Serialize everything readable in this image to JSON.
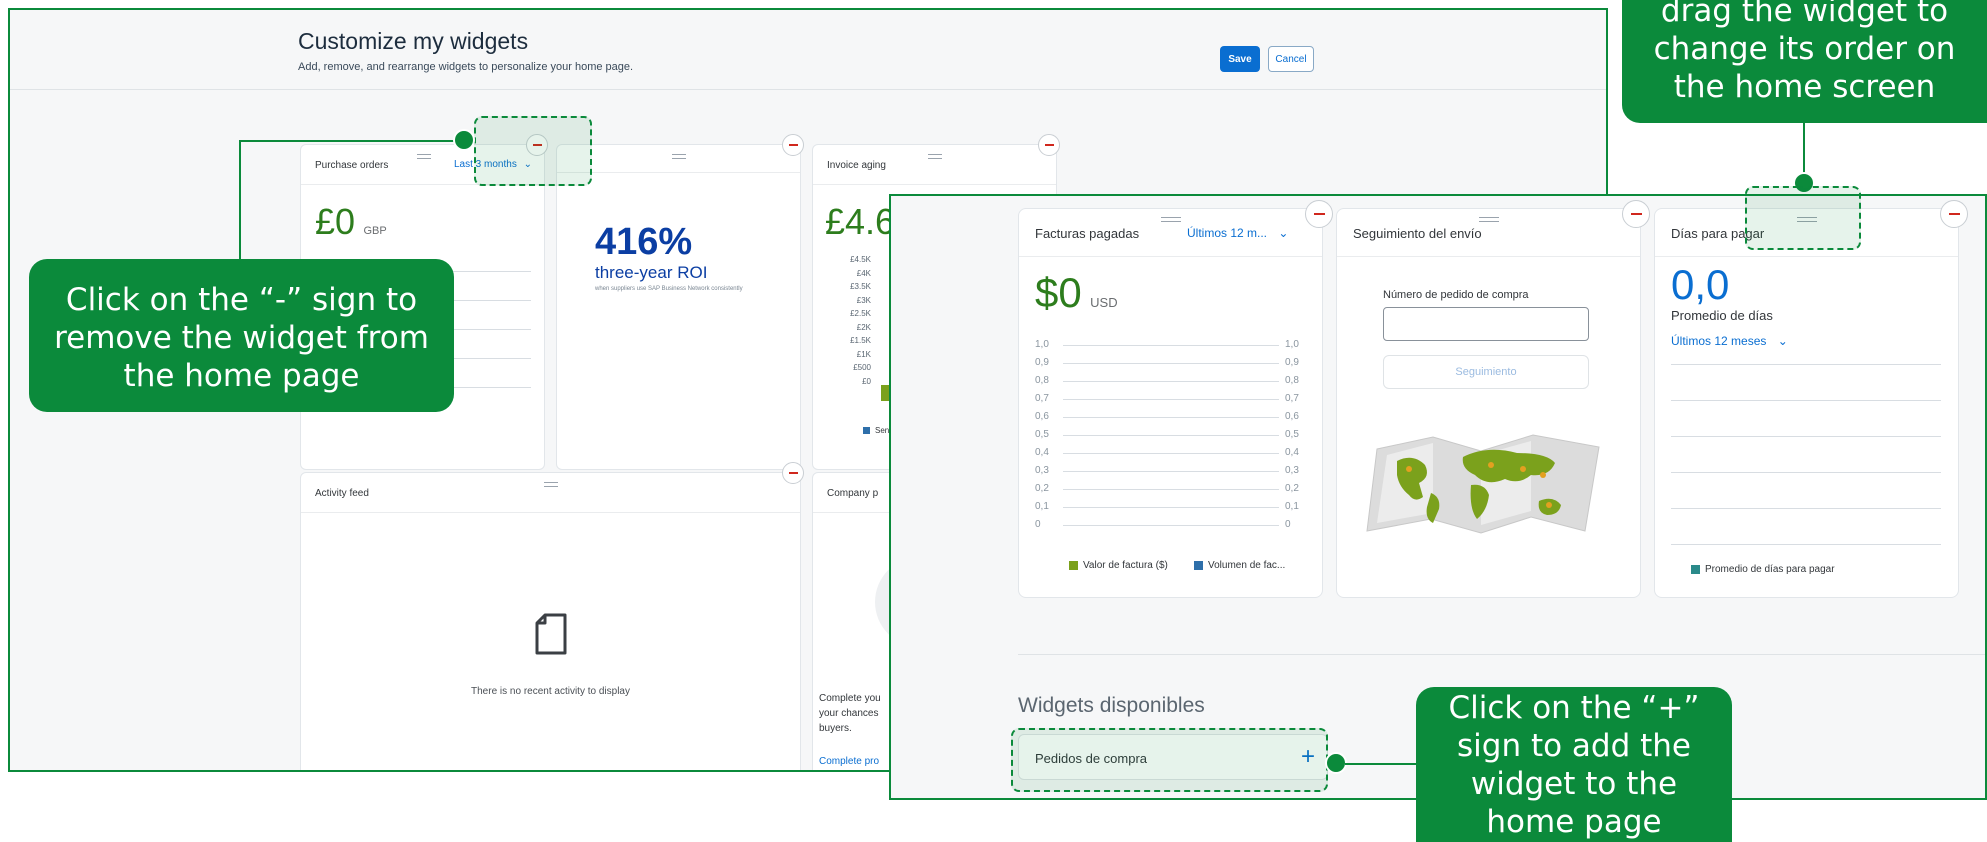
{
  "screen1": {
    "title": "Customize my widgets",
    "subtitle": "Add, remove, and rearrange widgets to personalize your home page.",
    "save_label": "Save",
    "cancel_label": "Cancel",
    "purchase_orders": {
      "title": "Purchase orders",
      "filter": "Last 3 months",
      "amount": "£0",
      "currency": "GBP"
    },
    "roi": {
      "value": "416%",
      "label": "three-year ROI",
      "note": "when suppliers use SAP Business Network consistently"
    },
    "invoice_aging": {
      "title": "Invoice aging",
      "amount": "£4.6",
      "y_ticks": [
        "£4.5K",
        "£4K",
        "£3.5K",
        "£3K",
        "£2.5K",
        "£2K",
        "£1.5K",
        "£1K",
        "£500",
        "£0"
      ],
      "legend": "Sen"
    },
    "activity_feed": {
      "title": "Activity feed",
      "empty_text": "There is no recent activity to display"
    },
    "company_profile": {
      "title": "Company p",
      "text": "Complete you your chances buyers.",
      "link": "Complete pro"
    }
  },
  "screen2": {
    "facturas": {
      "title": "Facturas pagadas",
      "filter": "Últimos 12 m...",
      "amount": "$0",
      "currency": "USD",
      "y_ticks": [
        "1,0",
        "0,9",
        "0,8",
        "0,7",
        "0,6",
        "0,5",
        "0,4",
        "0,3",
        "0,2",
        "0,1",
        "0"
      ],
      "legend_1": "Valor de factura ($)",
      "legend_2": "Volumen de fac...",
      "legend_1_color": "#7ba11c",
      "legend_2_color": "#2e6faa"
    },
    "seguimiento": {
      "title": "Seguimiento del envío",
      "field_label": "Número de pedido de compra",
      "field_value": "",
      "button": "Seguimiento"
    },
    "dias": {
      "title": "Días para pagar",
      "value": "0,0",
      "label": "Promedio de días",
      "filter": "Últimos 12 meses",
      "legend": "Promedio de días para pagar",
      "legend_color": "#2a8a8a"
    },
    "available_heading": "Widgets disponibles",
    "available_item": "Pedidos de compra"
  },
  "callouts": {
    "remove": "Click on the “-” sign to remove the widget from the home page",
    "drag": "drag the widget to change its order on the home screen",
    "add": "Click on the “+” sign to add the widget to the home page"
  },
  "colors": {
    "accent_green": "#0b8a3b",
    "primary_blue": "#0a6ed1",
    "remove_red": "#d0271d",
    "roi_blue": "#0b3ea3"
  }
}
